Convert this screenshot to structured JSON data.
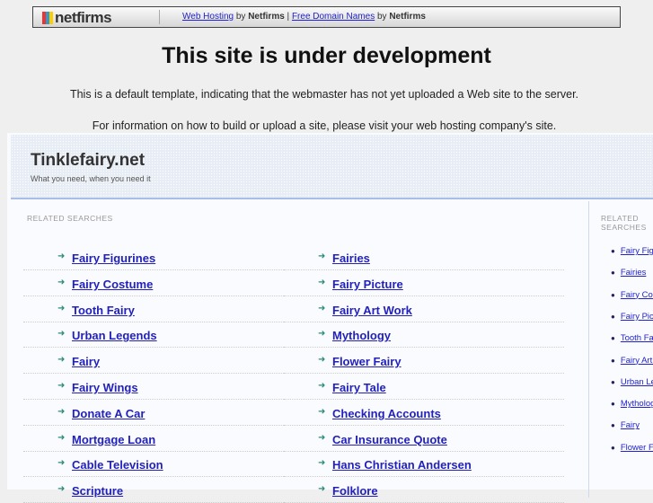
{
  "topbar": {
    "logo": "netfirms",
    "link1": "Web Hosting",
    "by1": " by ",
    "brand1": "Netfirms",
    "pipe": " | ",
    "link2": "Free Domain Names",
    "by2": " by ",
    "brand2": "Netfirms"
  },
  "title": "This site is under development",
  "info1": "This is a default template, indicating that the webmaster has not yet uploaded a Web site to the server.",
  "info2": "For information on how to build or upload a site, please visit your web hosting company's site.",
  "site": {
    "name": "Tinklefairy.net",
    "tagline": "What you need, when you need it"
  },
  "related_label": "RELATED SEARCHES",
  "left_col": [
    "Fairy Figurines",
    "Fairy Costume",
    "Tooth Fairy",
    "Urban Legends",
    "Fairy",
    "Fairy Wings",
    "Donate A Car",
    "Mortgage Loan",
    "Cable Television",
    "Scripture"
  ],
  "right_col": [
    "Fairies",
    "Fairy Picture",
    "Fairy Art Work",
    "Mythology",
    "Flower Fairy",
    "Fairy Tale",
    "Checking Accounts",
    "Car Insurance Quote",
    "Hans Christian Andersen",
    "Folklore"
  ],
  "side": {
    "label": "RELATED SEARCHES",
    "items": [
      "Fairy Figurines",
      "Fairies",
      "Fairy Costume",
      "Fairy Picture",
      "Tooth Fairy",
      "Fairy Art Work",
      "Urban Legends",
      "Mythology",
      "Fairy",
      "Flower Fairy"
    ]
  }
}
